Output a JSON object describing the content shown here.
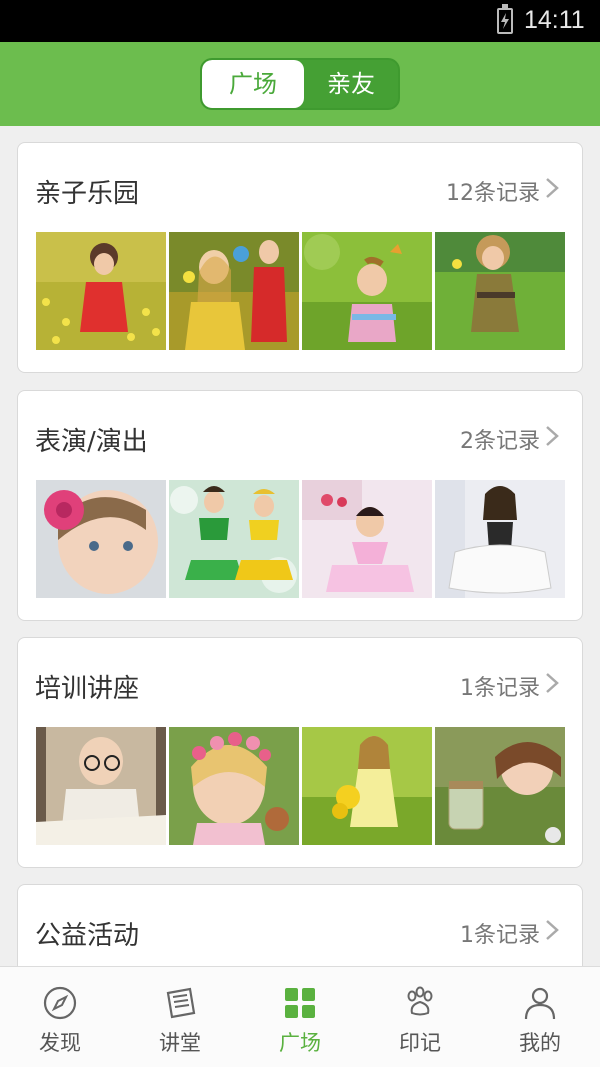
{
  "status_bar": {
    "time": "14:11"
  },
  "header": {
    "tabs": [
      {
        "label": "广场",
        "active": true
      },
      {
        "label": "亲友",
        "active": false
      }
    ]
  },
  "sections": [
    {
      "title": "亲子乐园",
      "count": "12条记录"
    },
    {
      "title": "表演/演出",
      "count": "2条记录"
    },
    {
      "title": "培训讲座",
      "count": "1条记录"
    },
    {
      "title": "公益活动",
      "count": "1条记录"
    }
  ],
  "bottom_nav": [
    {
      "label": "发现",
      "icon": "compass-icon",
      "active": false
    },
    {
      "label": "讲堂",
      "icon": "newspaper-icon",
      "active": false
    },
    {
      "label": "广场",
      "icon": "grid-icon",
      "active": true
    },
    {
      "label": "印记",
      "icon": "paw-icon",
      "active": false
    },
    {
      "label": "我的",
      "icon": "person-icon",
      "active": false
    }
  ],
  "colors": {
    "brand_green": "#6cbd4e",
    "active_green": "#5ab13f"
  }
}
